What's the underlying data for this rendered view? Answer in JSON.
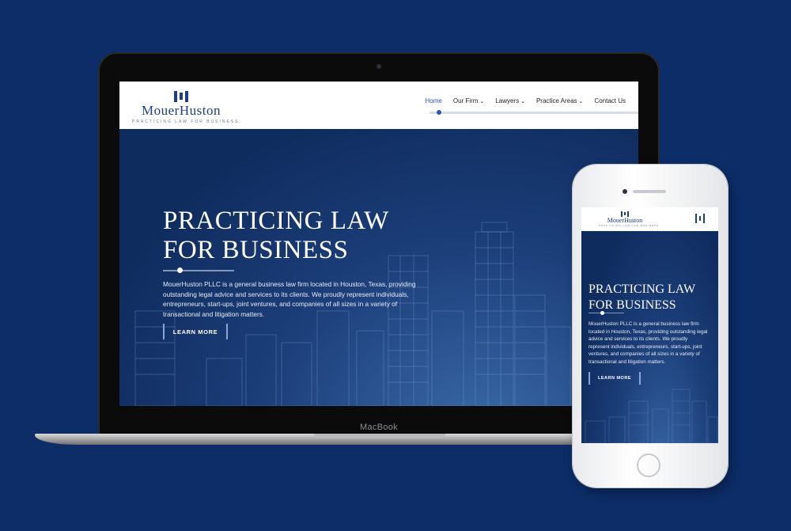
{
  "device": {
    "laptop_label": "MacBook"
  },
  "brand": {
    "name": "MouerHuston",
    "tagline": "PRACTICING LAW FOR BUSINESS"
  },
  "nav": {
    "items": [
      {
        "label": "Home",
        "active": true,
        "dropdown": false
      },
      {
        "label": "Our Firm",
        "active": false,
        "dropdown": true
      },
      {
        "label": "Lawyers",
        "active": false,
        "dropdown": true
      },
      {
        "label": "Practice Areas",
        "active": false,
        "dropdown": true
      },
      {
        "label": "Contact Us",
        "active": false,
        "dropdown": false
      }
    ]
  },
  "hero": {
    "title_line1": "PRACTICING LAW",
    "title_line2": "FOR BUSINESS",
    "body": "MouerHuston PLLC is a general business law firm located in Houston, Texas, providing outstanding legal advice and services to its clients. We proudly represent individuals, entrepreneurs, start-ups, joint ventures, and companies of all sizes in a variety of transactional and litigation matters.",
    "cta_label": "LEARN MORE"
  },
  "colors": {
    "background": "#0c2d68",
    "brand_navy": "#1b3f86",
    "accent_blue": "#2a55b8",
    "hero_dark": "#0f2c5e"
  },
  "icons": {
    "menu": "hamburger-vertical-icon",
    "dropdown": "chevron-down-icon",
    "logo_mark": "mh-logo-icon"
  }
}
